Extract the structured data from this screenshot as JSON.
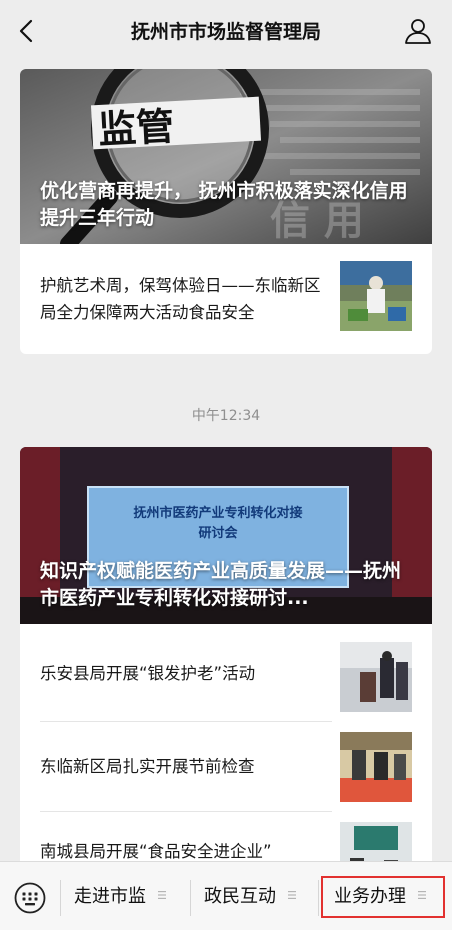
{
  "header": {
    "title": "抚州市市场监督管理局",
    "back_icon": "chevron-left-icon",
    "profile_icon": "person-icon"
  },
  "messages": [
    {
      "hero": {
        "caption": "优化营商再提升， 抚州市积极落实深化信用提升三年行动",
        "sign_text": "监管"
      },
      "items": [
        {
          "title": "护航艺术周，保驾体验日——东临新区局全力保障两大活动食品安全"
        }
      ]
    },
    {
      "timestamp": "中午12:34",
      "hero": {
        "caption": "知识产权赋能医药产业高质量发展——抚州市医药产业专利转化对接研讨...",
        "screen_line1": "抚州市医药产业专利转化对接",
        "screen_line2": "研讨会"
      },
      "items": [
        {
          "title": "乐安县局开展“银发护老”活动"
        },
        {
          "title": "东临新区局扎实开展节前检查"
        },
        {
          "title": "南城县局开展“食品安全进企业”"
        }
      ]
    }
  ],
  "bottom_menu": {
    "keyboard_icon": "keyboard-icon",
    "items": [
      {
        "label": "走进市监"
      },
      {
        "label": "政民互动"
      },
      {
        "label": "业务办理"
      }
    ],
    "highlight_color": "#e2312f"
  }
}
